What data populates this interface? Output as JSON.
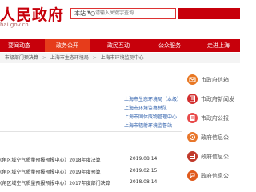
{
  "header": {
    "logo_text": "人民政府",
    "logo_sub": "hai.gov.cn",
    "search": {
      "scope": "本站",
      "placeholder": "请输入关键字查询"
    }
  },
  "nav": {
    "items": [
      {
        "label": "要闻动态",
        "active": false
      },
      {
        "label": "政务公开",
        "active": true
      },
      {
        "label": "政民互动",
        "active": false
      },
      {
        "label": "公众服务",
        "active": false
      },
      {
        "label": "走进上海",
        "active": false
      }
    ]
  },
  "breadcrumb": {
    "items": [
      "市级部门预决算",
      "上海市生态环境局",
      "上海市环境监测中心"
    ]
  },
  "departments": [
    "上海市生态环境局（本级）",
    "上海市环境监察总队",
    "上海市固体废物管理中心",
    "上海市辐射环境监督站"
  ],
  "documents": [
    {
      "title": "(角区域空气质量预报预报中心）2018年度决算",
      "date": "2019.08.14"
    },
    {
      "title": "(角区域空气质量预报预报中心）2019年度预算",
      "date": "2019.02.15"
    },
    {
      "title": "(角区域空气质量预报预报中心）2017年度部门决算",
      "date": "2018.08.14"
    }
  ],
  "sidebar": {
    "items": [
      {
        "label": "市政府信箱",
        "icon": "mailbox-icon",
        "color": "#e87722"
      },
      {
        "label": "市政府新闻发",
        "icon": "news-icon",
        "color": "#d32f2f"
      },
      {
        "label": "市政府公报",
        "icon": "bulletin-icon",
        "color": "#e84a4a"
      },
      {
        "label": "政府信息公",
        "icon": "info-icon",
        "color": "#e8772c"
      },
      {
        "label": "政府信息公",
        "icon": "info-catalog-icon",
        "color": "#c0392b"
      },
      {
        "label": "政府信息公",
        "icon": "info-request-icon",
        "color": "#e05a1c"
      }
    ]
  },
  "colors": {
    "brand": "#c7000b",
    "nav_active": "#e63c1b",
    "link": "#2a5caa"
  }
}
